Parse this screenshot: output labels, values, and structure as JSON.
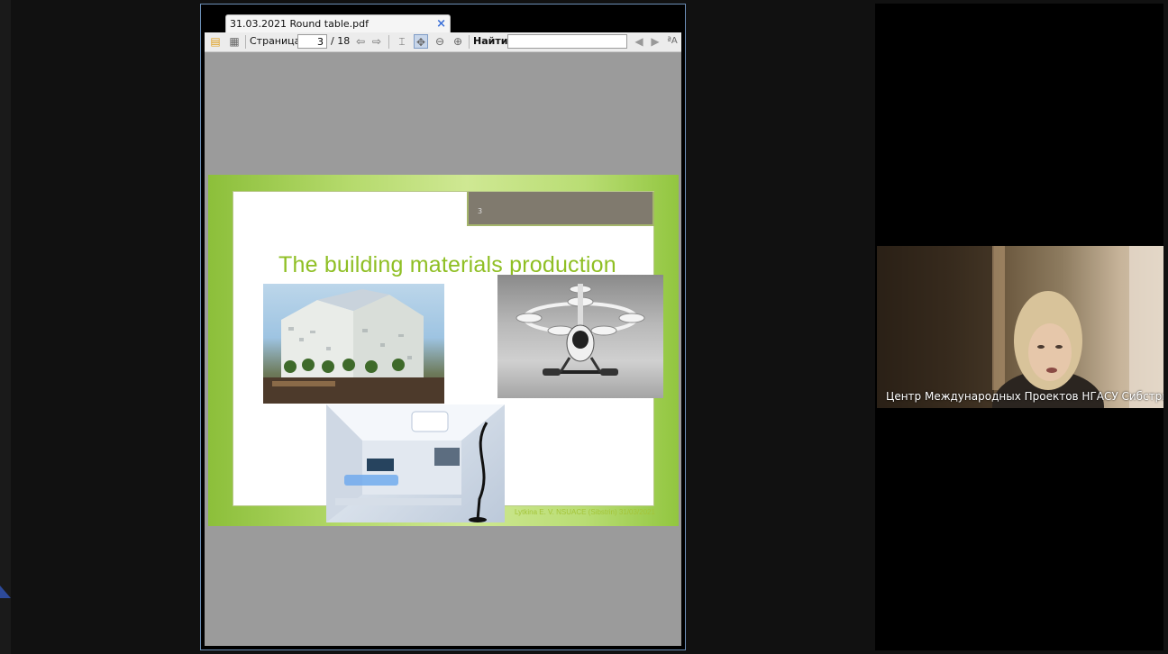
{
  "pdf_viewer": {
    "tab_title": "31.03.2021 Round table.pdf",
    "close_glyph": "×",
    "toolbar": {
      "page_label": "Страница:",
      "page_current": "3",
      "page_total": "/ 18",
      "find_label": "Найти:",
      "find_value": ""
    }
  },
  "slide": {
    "number": "3",
    "title": "The building materials production",
    "footer": "Lytkina E. V.  NSUACE (Sibstrin)   31/03/2021",
    "images": [
      "building-photo",
      "drone-photo",
      "interior-photo"
    ]
  },
  "video": {
    "participant_name": "Центр Международных Проектов НГАСУ Сибстрин"
  },
  "colors": {
    "accent_blue": "#3a6fd8",
    "slide_green": "#8fbf24",
    "window_border": "#6d8fb7"
  }
}
